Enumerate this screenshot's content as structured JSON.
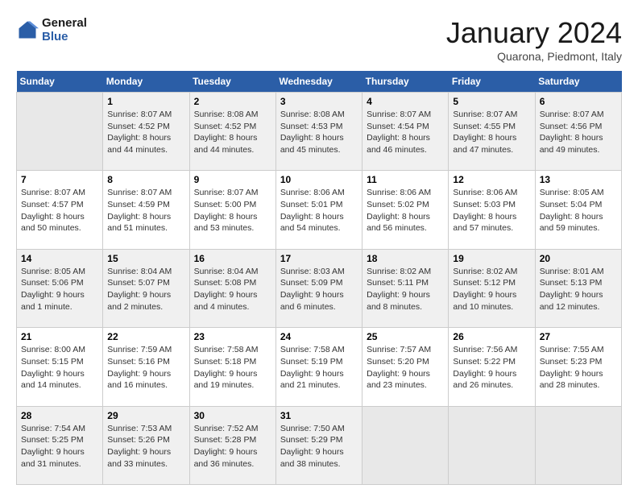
{
  "logo": {
    "line1": "General",
    "line2": "Blue"
  },
  "title": "January 2024",
  "subtitle": "Quarona, Piedmont, Italy",
  "days_of_week": [
    "Sunday",
    "Monday",
    "Tuesday",
    "Wednesday",
    "Thursday",
    "Friday",
    "Saturday"
  ],
  "weeks": [
    [
      {
        "day": "",
        "info": ""
      },
      {
        "day": "1",
        "info": "Sunrise: 8:07 AM\nSunset: 4:52 PM\nDaylight: 8 hours\nand 44 minutes."
      },
      {
        "day": "2",
        "info": "Sunrise: 8:08 AM\nSunset: 4:52 PM\nDaylight: 8 hours\nand 44 minutes."
      },
      {
        "day": "3",
        "info": "Sunrise: 8:08 AM\nSunset: 4:53 PM\nDaylight: 8 hours\nand 45 minutes."
      },
      {
        "day": "4",
        "info": "Sunrise: 8:07 AM\nSunset: 4:54 PM\nDaylight: 8 hours\nand 46 minutes."
      },
      {
        "day": "5",
        "info": "Sunrise: 8:07 AM\nSunset: 4:55 PM\nDaylight: 8 hours\nand 47 minutes."
      },
      {
        "day": "6",
        "info": "Sunrise: 8:07 AM\nSunset: 4:56 PM\nDaylight: 8 hours\nand 49 minutes."
      }
    ],
    [
      {
        "day": "7",
        "info": "Sunrise: 8:07 AM\nSunset: 4:57 PM\nDaylight: 8 hours\nand 50 minutes."
      },
      {
        "day": "8",
        "info": "Sunrise: 8:07 AM\nSunset: 4:59 PM\nDaylight: 8 hours\nand 51 minutes."
      },
      {
        "day": "9",
        "info": "Sunrise: 8:07 AM\nSunset: 5:00 PM\nDaylight: 8 hours\nand 53 minutes."
      },
      {
        "day": "10",
        "info": "Sunrise: 8:06 AM\nSunset: 5:01 PM\nDaylight: 8 hours\nand 54 minutes."
      },
      {
        "day": "11",
        "info": "Sunrise: 8:06 AM\nSunset: 5:02 PM\nDaylight: 8 hours\nand 56 minutes."
      },
      {
        "day": "12",
        "info": "Sunrise: 8:06 AM\nSunset: 5:03 PM\nDaylight: 8 hours\nand 57 minutes."
      },
      {
        "day": "13",
        "info": "Sunrise: 8:05 AM\nSunset: 5:04 PM\nDaylight: 8 hours\nand 59 minutes."
      }
    ],
    [
      {
        "day": "14",
        "info": "Sunrise: 8:05 AM\nSunset: 5:06 PM\nDaylight: 9 hours\nand 1 minute."
      },
      {
        "day": "15",
        "info": "Sunrise: 8:04 AM\nSunset: 5:07 PM\nDaylight: 9 hours\nand 2 minutes."
      },
      {
        "day": "16",
        "info": "Sunrise: 8:04 AM\nSunset: 5:08 PM\nDaylight: 9 hours\nand 4 minutes."
      },
      {
        "day": "17",
        "info": "Sunrise: 8:03 AM\nSunset: 5:09 PM\nDaylight: 9 hours\nand 6 minutes."
      },
      {
        "day": "18",
        "info": "Sunrise: 8:02 AM\nSunset: 5:11 PM\nDaylight: 9 hours\nand 8 minutes."
      },
      {
        "day": "19",
        "info": "Sunrise: 8:02 AM\nSunset: 5:12 PM\nDaylight: 9 hours\nand 10 minutes."
      },
      {
        "day": "20",
        "info": "Sunrise: 8:01 AM\nSunset: 5:13 PM\nDaylight: 9 hours\nand 12 minutes."
      }
    ],
    [
      {
        "day": "21",
        "info": "Sunrise: 8:00 AM\nSunset: 5:15 PM\nDaylight: 9 hours\nand 14 minutes."
      },
      {
        "day": "22",
        "info": "Sunrise: 7:59 AM\nSunset: 5:16 PM\nDaylight: 9 hours\nand 16 minutes."
      },
      {
        "day": "23",
        "info": "Sunrise: 7:58 AM\nSunset: 5:18 PM\nDaylight: 9 hours\nand 19 minutes."
      },
      {
        "day": "24",
        "info": "Sunrise: 7:58 AM\nSunset: 5:19 PM\nDaylight: 9 hours\nand 21 minutes."
      },
      {
        "day": "25",
        "info": "Sunrise: 7:57 AM\nSunset: 5:20 PM\nDaylight: 9 hours\nand 23 minutes."
      },
      {
        "day": "26",
        "info": "Sunrise: 7:56 AM\nSunset: 5:22 PM\nDaylight: 9 hours\nand 26 minutes."
      },
      {
        "day": "27",
        "info": "Sunrise: 7:55 AM\nSunset: 5:23 PM\nDaylight: 9 hours\nand 28 minutes."
      }
    ],
    [
      {
        "day": "28",
        "info": "Sunrise: 7:54 AM\nSunset: 5:25 PM\nDaylight: 9 hours\nand 31 minutes."
      },
      {
        "day": "29",
        "info": "Sunrise: 7:53 AM\nSunset: 5:26 PM\nDaylight: 9 hours\nand 33 minutes."
      },
      {
        "day": "30",
        "info": "Sunrise: 7:52 AM\nSunset: 5:28 PM\nDaylight: 9 hours\nand 36 minutes."
      },
      {
        "day": "31",
        "info": "Sunrise: 7:50 AM\nSunset: 5:29 PM\nDaylight: 9 hours\nand 38 minutes."
      },
      {
        "day": "",
        "info": ""
      },
      {
        "day": "",
        "info": ""
      },
      {
        "day": "",
        "info": ""
      }
    ]
  ]
}
